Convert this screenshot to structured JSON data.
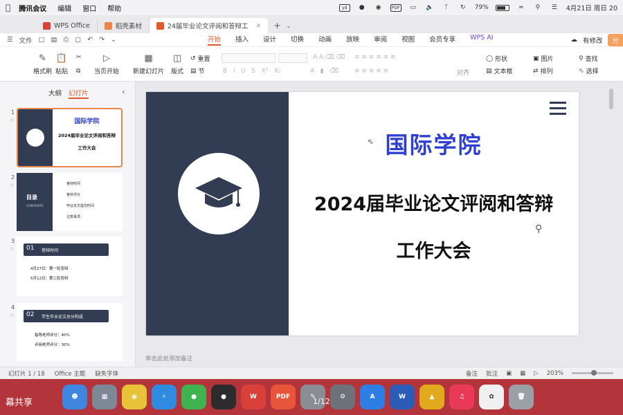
{
  "menubar": {
    "app_name": "腾讯会议",
    "items": [
      "编辑",
      "窗口",
      "帮助"
    ],
    "battery": "79%",
    "datetime": "4月21日 周日 20",
    "status_icons": [
      "yd",
      "PDF"
    ]
  },
  "tabs": [
    {
      "label": "WPS Office",
      "color": "#d9403a"
    },
    {
      "label": "稻壳素材",
      "color": "#e8864e"
    },
    {
      "label": "24届毕业论文评阅和答辩工",
      "color": "#e05a2b"
    }
  ],
  "menurow": {
    "file": "文件",
    "tabs": [
      "开始",
      "插入",
      "设计",
      "切换",
      "动画",
      "放映",
      "审阅",
      "视图",
      "会员专享"
    ],
    "active_tab": "开始",
    "wps_ai": "WPS AI",
    "has_changes": "有修改",
    "share": "分"
  },
  "ribbon": {
    "format_painter": "格式刷",
    "paste": "粘贴",
    "play_from_current": "当页开始",
    "new_slide": "新建幻灯片",
    "layout": "版式",
    "reset": "重置",
    "section": "节",
    "align": "对齐",
    "shape": "形状",
    "picture": "图片",
    "textbox": "文本框",
    "arrange": "排列",
    "find": "查找",
    "select": "选择"
  },
  "leftpanel": {
    "outline": "大纲",
    "slides": "幻灯片",
    "thumb1": {
      "title": "国际学院",
      "line1": "2024届毕业论文评阅和答辩",
      "line2": "工作大会"
    },
    "thumb2": {
      "title": "目录",
      "sub": "CONTENTS",
      "items": [
        "答辩时间",
        "答辩评分",
        "毕业论文提交时间",
        "注意事项"
      ]
    },
    "thumb3": {
      "num": "01",
      "title": "答辩时间",
      "items": [
        "4月27日：第一轮答辩",
        "5月12日：第二轮答辩"
      ]
    },
    "thumb4": {
      "num": "02",
      "title": "学生毕业论文总分构成",
      "items": [
        "指导老师评分：40%",
        "评阅老师评分：30%"
      ]
    },
    "slide_numbers": [
      "1",
      "2",
      "3",
      "4"
    ]
  },
  "slide": {
    "title1": "国际学院",
    "title2": "2024届毕业论文评阅和答辩",
    "title3": "工作大会",
    "notes_placeholder": "单击此处添加备注",
    "colors": {
      "navy": "#323c52",
      "blue_title": "#2f3fd0"
    }
  },
  "statusbar": {
    "slide_count": "幻灯片 1 / 18",
    "theme": "Office 主题",
    "missing_font": "缺失字体",
    "notes": "备注",
    "comments": "批注",
    "zoom": "203%"
  },
  "dock": {
    "label": "幕共享",
    "page_indicator": "1/12",
    "apps": [
      "finder",
      "launchpad",
      "chrome",
      "safari",
      "wechat",
      "qq",
      "wps",
      "pdf",
      "notes",
      "settings",
      "appstore",
      "word",
      "keynote",
      "music",
      "photos",
      "trash"
    ]
  }
}
